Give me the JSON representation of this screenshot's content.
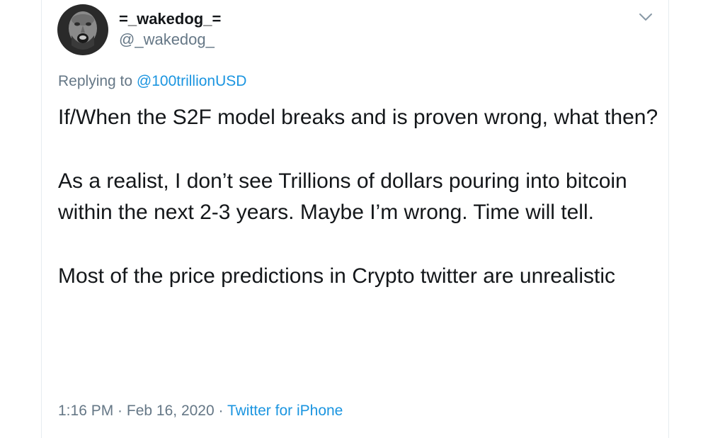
{
  "user": {
    "display_name": "=_wakedog_=",
    "handle": "@_wakedog_"
  },
  "reply": {
    "prefix": "Replying to ",
    "mention": "@100trillionUSD"
  },
  "tweet": {
    "paragraphs": [
      "If/When the S2F model breaks and is proven wrong, what then?",
      "As a realist, I don’t see Trillions of dollars pouring into bitcoin within the next 2-3 years. Maybe I’m wrong. Time will tell.",
      "Most of the price predictions in Crypto twitter are unrealistic"
    ]
  },
  "meta": {
    "time": "1:16 PM",
    "separator": " · ",
    "date": "Feb 16, 2020",
    "source": "Twitter for iPhone"
  },
  "colors": {
    "text": "#14171a",
    "secondary": "#657786",
    "link": "#1b95e0",
    "border": "#e6ecf0"
  },
  "icons": {
    "menu": "chevron-down-icon",
    "avatar": "avatar"
  }
}
